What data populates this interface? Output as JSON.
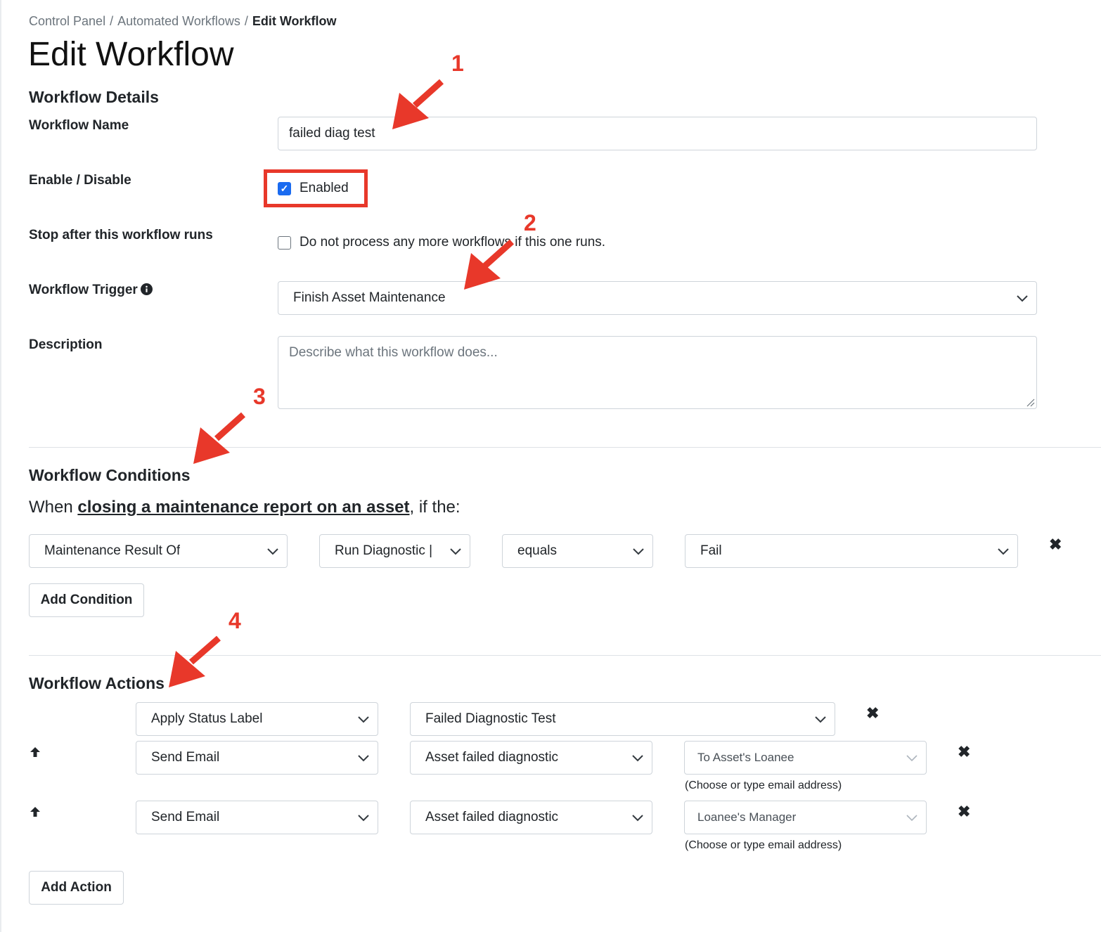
{
  "breadcrumb": {
    "items": [
      "Control Panel",
      "Automated Workflows"
    ],
    "separator": "/",
    "current": "Edit Workflow"
  },
  "page_title": "Edit Workflow",
  "details": {
    "heading": "Workflow Details",
    "name_label": "Workflow Name",
    "name_value": "failed diag test",
    "enable_label": "Enable / Disable",
    "enabled_text": "Enabled",
    "enabled_checked": true,
    "stop_label": "Stop after this workflow runs",
    "stop_text": "Do not process any more workflows if this one runs.",
    "stop_checked": false,
    "trigger_label": "Workflow Trigger",
    "trigger_value": "Finish Asset Maintenance",
    "description_label": "Description",
    "description_placeholder": "Describe what this workflow does..."
  },
  "conditions": {
    "heading": "Workflow Conditions",
    "when_prefix": "When ",
    "when_link": "closing a maintenance report on an asset",
    "when_suffix": ", if the:",
    "rows": [
      {
        "field": "Maintenance Result Of",
        "subfield": "Run Diagnostic |",
        "operator": "equals",
        "value": "Fail"
      }
    ],
    "add_button": "Add Condition"
  },
  "actions": {
    "heading": "Workflow Actions",
    "rows": [
      {
        "type": "Apply Status Label",
        "target": "Failed Diagnostic Test"
      },
      {
        "type": "Send Email",
        "template": "Asset failed diagnostic",
        "recipient": "To Asset's Loanee",
        "help": "(Choose or type email address)"
      },
      {
        "type": "Send Email",
        "template": "Asset failed diagnostic",
        "recipient": "Loanee's Manager",
        "help": "(Choose or type email address)"
      }
    ],
    "add_button": "Add Action"
  },
  "annotations": [
    "1",
    "2",
    "3",
    "4"
  ],
  "colors": {
    "annotation_red": "#e8382a",
    "checkbox_blue": "#1a6bf0",
    "border": "#ced4da"
  },
  "icons": {
    "select_chevron": "chevron-down-icon",
    "remove": "close-icon",
    "move_up": "arrow-up-icon",
    "info": "info-icon",
    "check": "checkmark-icon"
  }
}
